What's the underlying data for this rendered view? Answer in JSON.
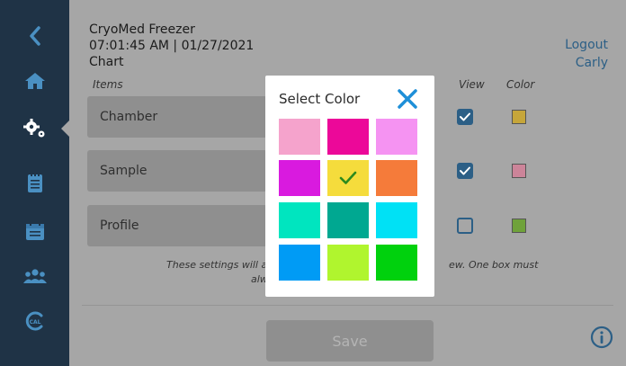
{
  "sidebar": {
    "items": [
      {
        "name": "back",
        "icon": "chevron-left-icon"
      },
      {
        "name": "home",
        "icon": "home-icon"
      },
      {
        "name": "settings",
        "icon": "gears-icon",
        "active": true
      },
      {
        "name": "notebook",
        "icon": "notebook-icon"
      },
      {
        "name": "calendar",
        "icon": "calendar-icon"
      },
      {
        "name": "users",
        "icon": "users-icon"
      },
      {
        "name": "calibration",
        "icon": "calibration-icon",
        "label": "CAL"
      }
    ]
  },
  "header": {
    "device_name": "CryoMed Freezer",
    "datetime": "07:01:45 AM | 01/27/2021",
    "section": "Chart"
  },
  "user": {
    "logout_label": "Logout",
    "username": "Carly"
  },
  "columns": {
    "items": "Items",
    "view": "View",
    "color": "Color"
  },
  "rows": [
    {
      "label": "Chamber",
      "view": true,
      "color": "#c6a63a"
    },
    {
      "label": "Sample",
      "view": true,
      "color": "#cc8499"
    },
    {
      "label": "Profile",
      "view": false,
      "color": "#6fa23a"
    }
  ],
  "note": {
    "line1_left": "These settings will aff",
    "line1_right": "ew. One box must",
    "line2": "alw"
  },
  "save_label": "Save",
  "colors": {
    "sidebar_bg": "#1f3346",
    "icon_blue": "#4a90c2",
    "accent": "#2c5f86"
  },
  "modal": {
    "title": "Select Color",
    "close_icon": "close-icon",
    "selected_index": 4,
    "swatches": [
      "#f5a3cc",
      "#ec0899",
      "#f593f2",
      "#d91adf",
      "#f5dc3c",
      "#f57b3a",
      "#00e5bf",
      "#00a891",
      "#00e1f5",
      "#009bf5",
      "#b0f52e",
      "#00d10d"
    ]
  }
}
